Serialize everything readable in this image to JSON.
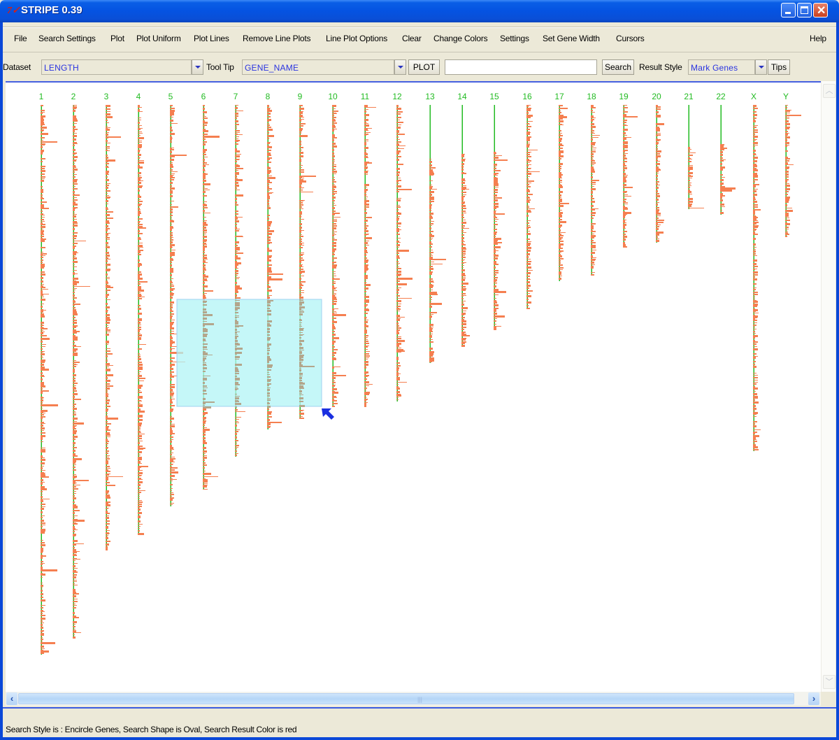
{
  "window": {
    "title": "STRIPE 0.39",
    "app_icon": "tk-feather-icon",
    "controls": [
      "minimize",
      "maximize",
      "close"
    ]
  },
  "menubar": {
    "items": [
      {
        "label": "File"
      },
      {
        "label": "Search Settings"
      },
      {
        "label": "Plot"
      },
      {
        "label": "Plot Uniform"
      },
      {
        "label": "Plot Lines"
      },
      {
        "label": "Remove Line Plots"
      },
      {
        "label": "Line Plot Options"
      },
      {
        "label": "Clear"
      },
      {
        "label": "Change Colors"
      },
      {
        "label": "Settings"
      },
      {
        "label": "Set Gene Width"
      },
      {
        "label": "Cursors"
      }
    ],
    "help_label": "Help"
  },
  "toolbar": {
    "dataset_label": "Dataset",
    "dataset_value": "LENGTH",
    "tooltip_label": "Tool Tip",
    "tooltip_value": "GENE_NAME",
    "plot_button": "PLOT",
    "search_input_value": "",
    "search_button": "Search",
    "result_style_label": "Result Style",
    "result_style_value": "Mark Genes",
    "tips_button": "Tips"
  },
  "colors": {
    "gene_bar": "#f57f50",
    "chromosome_gap": "#22bb22",
    "label": "#22bb22",
    "selection_fill": "#b2f4f6",
    "selection_border": "#9fd0f0",
    "selected_gene": "#b3a68c",
    "cursor": "#1a2fe0"
  },
  "plot": {
    "chromosomes": [
      {
        "name": "1",
        "relative_length": 1.0
      },
      {
        "name": "2",
        "relative_length": 0.97
      },
      {
        "name": "3",
        "relative_length": 0.81
      },
      {
        "name": "4",
        "relative_length": 0.78
      },
      {
        "name": "5",
        "relative_length": 0.73
      },
      {
        "name": "6",
        "relative_length": 0.7
      },
      {
        "name": "7",
        "relative_length": 0.64
      },
      {
        "name": "8",
        "relative_length": 0.59
      },
      {
        "name": "9",
        "relative_length": 0.57
      },
      {
        "name": "10",
        "relative_length": 0.55
      },
      {
        "name": "11",
        "relative_length": 0.55
      },
      {
        "name": "12",
        "relative_length": 0.54
      },
      {
        "name": "13",
        "relative_length": 0.47
      },
      {
        "name": "14",
        "relative_length": 0.44
      },
      {
        "name": "15",
        "relative_length": 0.41
      },
      {
        "name": "16",
        "relative_length": 0.37
      },
      {
        "name": "17",
        "relative_length": 0.32
      },
      {
        "name": "18",
        "relative_length": 0.31
      },
      {
        "name": "19",
        "relative_length": 0.26
      },
      {
        "name": "20",
        "relative_length": 0.25
      },
      {
        "name": "21",
        "relative_length": 0.19
      },
      {
        "name": "22",
        "relative_length": 0.2
      },
      {
        "name": "X",
        "relative_length": 0.63
      },
      {
        "name": "Y",
        "relative_length": 0.24
      }
    ],
    "selection": {
      "chromosomes_covered": [
        "6",
        "7",
        "8",
        "9"
      ],
      "active": true
    }
  },
  "status": {
    "text": "Search Style is : Encircle Genes, Search Shape is Oval, Search Result Color is red"
  }
}
